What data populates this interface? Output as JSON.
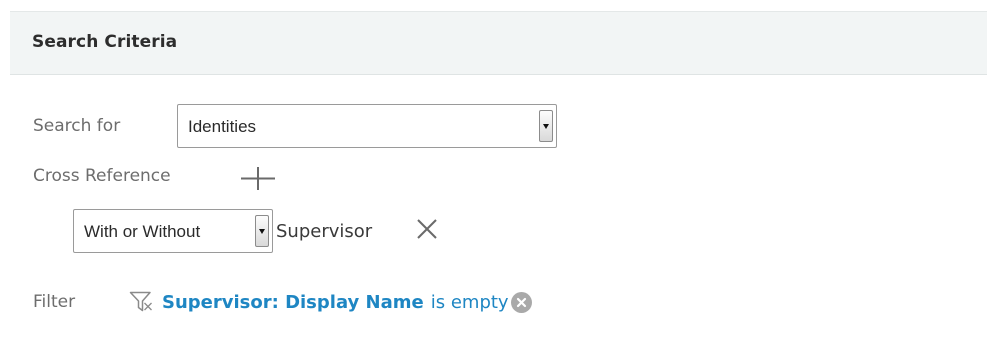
{
  "panel": {
    "title": "Search Criteria"
  },
  "search_for": {
    "label": "Search for",
    "selected": "Identities"
  },
  "cross_reference": {
    "label": "Cross Reference",
    "add_icon": "plus-icon",
    "qualifier_selected": "With or Without",
    "target": "Supervisor",
    "remove_icon": "close-x-icon"
  },
  "filter": {
    "label": "Filter",
    "icon": "funnel-filter-icon",
    "field": "Supervisor: Display Name",
    "operator": "is empty",
    "remove_icon": "circle-x-icon"
  },
  "colors": {
    "header_bg": "#f2f5f5",
    "label_text": "#6d6d6d",
    "link_blue": "#1e86c3",
    "remove_badge": "#a9a9a9"
  }
}
